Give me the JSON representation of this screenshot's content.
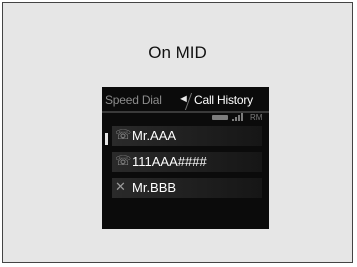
{
  "caption": "On MID",
  "display": {
    "tab_left": "Speed Dial",
    "tab_arrow": "◄",
    "tab_right": "Call History",
    "status_rm": "RM",
    "rows": [
      {
        "icon": "incoming-call-icon",
        "glyph": "☏",
        "label": "Mr.AAA"
      },
      {
        "icon": "incoming-call-icon",
        "glyph": "☏",
        "label": "111AAA####"
      },
      {
        "icon": "missed-call-icon",
        "glyph": "✕",
        "label": "Mr.BBB"
      }
    ]
  }
}
